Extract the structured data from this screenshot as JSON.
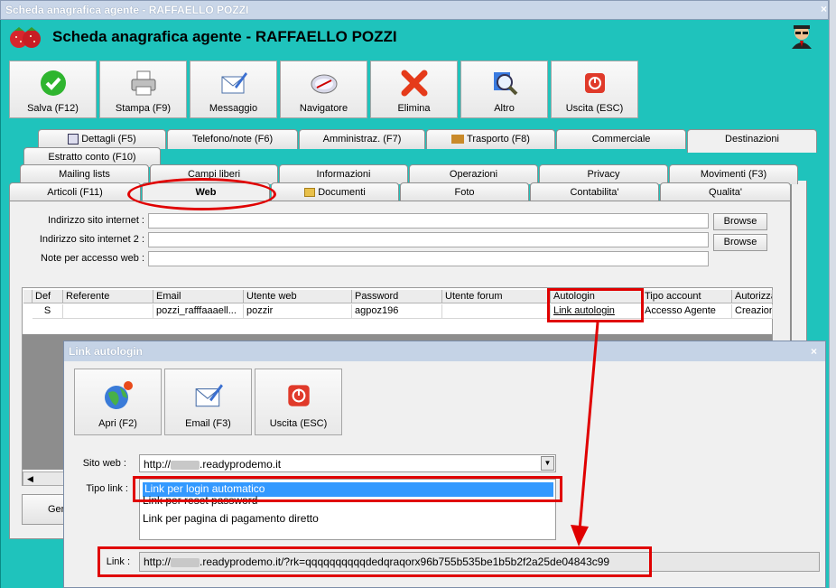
{
  "window": {
    "title": "Scheda anagrafica agente - RAFFAELLO POZZI",
    "close": "×"
  },
  "header": {
    "title": "Scheda anagrafica agente - RAFFAELLO POZZI"
  },
  "toolbar": [
    {
      "label": "Salva (F12)",
      "icon": "check-icon"
    },
    {
      "label": "Stampa (F9)",
      "icon": "printer-icon"
    },
    {
      "label": "Messaggio",
      "icon": "mail-pen-icon"
    },
    {
      "label": "Navigatore",
      "icon": "compass-icon"
    },
    {
      "label": "Elimina",
      "icon": "delete-x-icon"
    },
    {
      "label": "Altro",
      "icon": "magnifier-icon"
    },
    {
      "label": "Uscita (ESC)",
      "icon": "exit-icon"
    }
  ],
  "tabs": {
    "row1": [
      "Dettagli (F5)",
      "Telefono/note (F6)",
      "Amministraz. (F7)",
      "Trasporto (F8)",
      "Commerciale",
      "Destinazioni"
    ],
    "row2": [
      "Estratto conto (F10)"
    ],
    "row3": [
      "Mailing lists",
      "Campi liberi",
      "Informazioni",
      "Operazioni",
      "Privacy",
      "Movimenti (F3)"
    ],
    "row4": [
      "Articoli (F11)",
      "Web",
      "Documenti",
      "Foto",
      "Contabilita'",
      "Qualita'"
    ]
  },
  "form": {
    "site_label": "Indirizzo sito internet :",
    "site2_label": "Indirizzo sito internet 2 :",
    "notes_label": "Note per accesso web :",
    "browse": "Browse"
  },
  "grid": {
    "headers": [
      "Def",
      "Referente",
      "Email",
      "Utente web",
      "Password",
      "Utente forum",
      "Autologin",
      "Tipo account",
      "Autorizza"
    ],
    "row": [
      "S",
      "",
      "pozzi_rafffaaaell...",
      "pozzir",
      "agpoz196",
      "",
      "Link autologin",
      "Accesso Agente",
      "Creazion"
    ]
  },
  "bottom_button_partial": "Gen",
  "dialog": {
    "title": "Link autologin",
    "close": "×",
    "buttons": [
      {
        "label": "Apri (F2)",
        "icon": "globe-icon"
      },
      {
        "label": "Email (F3)",
        "icon": "mail-pen-icon"
      },
      {
        "label": "Uscita (ESC)",
        "icon": "exit-icon"
      }
    ],
    "site_label": "Sito web :",
    "site_prefix": "http://",
    "site_suffix": ".readyprodemo.it",
    "type_label": "Tipo link :",
    "link_types": [
      "Link per login automatico",
      "Link per reset password",
      "Link per pagina di pagamento diretto"
    ],
    "link_label": "Link :",
    "link_prefix": "http://",
    "link_suffix": ".readyprodemo.it/?rk=qqqqqqqqqqdedqraqorx96b755b535be1b5b2f2a25de04843c99"
  }
}
